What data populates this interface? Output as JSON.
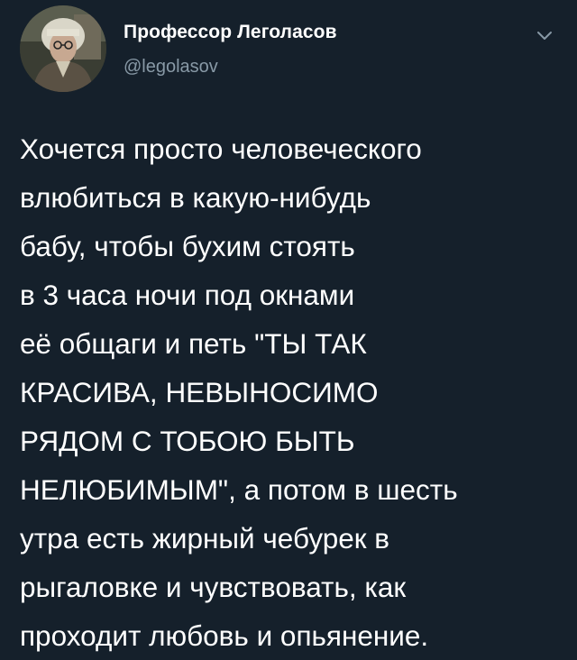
{
  "author": {
    "display_name": "Профессор Леголасов",
    "handle": "@legolasov",
    "avatar_icon": "user-avatar-icon"
  },
  "menu": {
    "caret_icon": "chevron-down-icon"
  },
  "tweet": {
    "lines": [
      "Хочется просто человеческого",
      "влюбиться в какую-нибудь",
      "бабу, чтобы бухим стоять",
      "в 3 часа ночи под окнами",
      "её общаги и петь \"ТЫ ТАК",
      "КРАСИВА, НЕВЫНОСИМО",
      "РЯДОМ С ТОБОЮ БЫТЬ",
      "НЕЛЮБИМЫМ\", а потом в шесть",
      "утра есть жирный чебурек в",
      "рыгаловке и чувствовать, как",
      "проходит любовь и опьянение."
    ]
  },
  "colors": {
    "background": "#15202b",
    "text": "#ffffff",
    "secondary_text": "#8899a6"
  }
}
